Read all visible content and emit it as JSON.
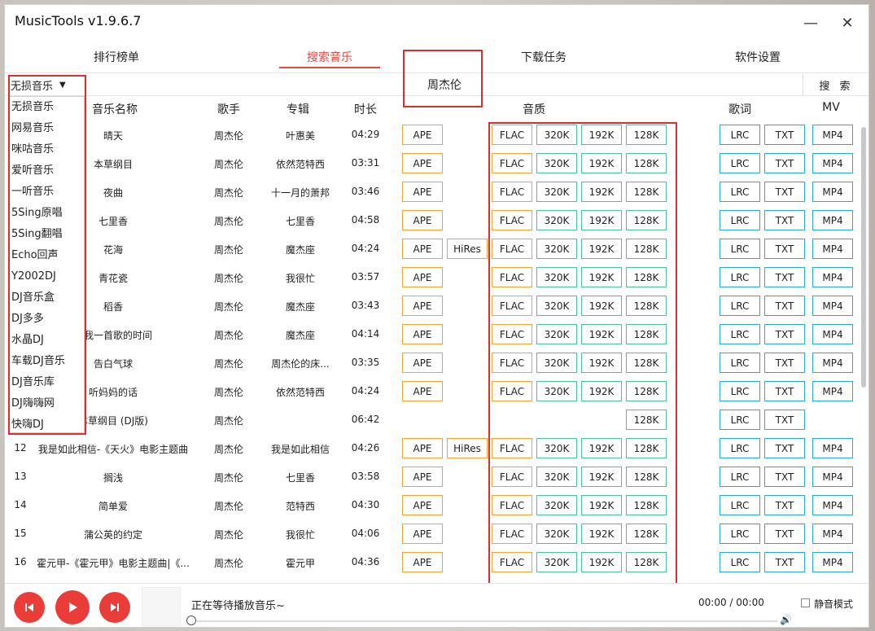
{
  "window": {
    "title": "MusicTools v1.9.6.7",
    "minimize": "—",
    "close": "✕"
  },
  "tabs": [
    {
      "label": "排行榜单"
    },
    {
      "label": "搜索音乐"
    },
    {
      "label": "下载任务"
    },
    {
      "label": "软件设置"
    }
  ],
  "active_tab": "搜索音乐",
  "search": {
    "source_selected": "无损音乐",
    "query": "周杰伦",
    "button": "搜 索"
  },
  "columns": {
    "title": "音乐名称",
    "artist": "歌手",
    "album": "专辑",
    "duration": "时长",
    "quality": "音质",
    "lyrics": "歌词",
    "mv": "MV"
  },
  "sources": [
    "无损音乐",
    "网易音乐",
    "咪咕音乐",
    "爱听音乐",
    "一听音乐",
    "5Sing原唱",
    "5Sing翻唱",
    "Echo回声",
    "Y2002DJ",
    "DJ音乐盒",
    "DJ多多",
    "水晶DJ",
    "车载DJ音乐",
    "DJ音乐库",
    "DJ嗨嗨网",
    "快嗨DJ"
  ],
  "songs": [
    {
      "num": "",
      "title": "晴天",
      "artist": "周杰伦",
      "album": "叶惠美",
      "duration": "04:29",
      "ape": "APE",
      "hires": "",
      "flac": "FLAC",
      "q320": "320K",
      "q192": "192K",
      "q128": "128K",
      "lrc": "LRC",
      "txt": "TXT",
      "mv": "MP4"
    },
    {
      "num": "",
      "title": "本草纲目",
      "artist": "周杰伦",
      "album": "依然范特西",
      "duration": "03:31",
      "ape": "APE",
      "hires": "",
      "flac": "FLAC",
      "q320": "320K",
      "q192": "192K",
      "q128": "128K",
      "lrc": "LRC",
      "txt": "TXT",
      "mv": "MP4"
    },
    {
      "num": "",
      "title": "夜曲",
      "artist": "周杰伦",
      "album": "十一月的萧邦",
      "duration": "03:46",
      "ape": "APE",
      "hires": "",
      "flac": "FLAC",
      "q320": "320K",
      "q192": "192K",
      "q128": "128K",
      "lrc": "LRC",
      "txt": "TXT",
      "mv": "MP4"
    },
    {
      "num": "",
      "title": "七里香",
      "artist": "周杰伦",
      "album": "七里香",
      "duration": "04:58",
      "ape": "APE",
      "hires": "",
      "flac": "FLAC",
      "q320": "320K",
      "q192": "192K",
      "q128": "128K",
      "lrc": "LRC",
      "txt": "TXT",
      "mv": "MP4"
    },
    {
      "num": "",
      "title": "花海",
      "artist": "周杰伦",
      "album": "魔杰座",
      "duration": "04:24",
      "ape": "APE",
      "hires": "HiRes",
      "flac": "FLAC",
      "q320": "320K",
      "q192": "192K",
      "q128": "128K",
      "lrc": "LRC",
      "txt": "TXT",
      "mv": "MP4"
    },
    {
      "num": "",
      "title": "青花瓷",
      "artist": "周杰伦",
      "album": "我很忙",
      "duration": "03:57",
      "ape": "APE",
      "hires": "",
      "flac": "FLAC",
      "q320": "320K",
      "q192": "192K",
      "q128": "128K",
      "lrc": "LRC",
      "txt": "TXT",
      "mv": "MP4"
    },
    {
      "num": "",
      "title": "稻香",
      "artist": "周杰伦",
      "album": "魔杰座",
      "duration": "03:43",
      "ape": "APE",
      "hires": "",
      "flac": "FLAC",
      "q320": "320K",
      "q192": "192K",
      "q128": "128K",
      "lrc": "LRC",
      "txt": "TXT",
      "mv": "MP4"
    },
    {
      "num": "",
      "title": "给我一首歌的时间",
      "artist": "周杰伦",
      "album": "魔杰座",
      "duration": "04:14",
      "ape": "APE",
      "hires": "",
      "flac": "FLAC",
      "q320": "320K",
      "q192": "192K",
      "q128": "128K",
      "lrc": "LRC",
      "txt": "TXT",
      "mv": "MP4"
    },
    {
      "num": "",
      "title": "告白气球",
      "artist": "周杰伦",
      "album": "周杰伦的床...",
      "duration": "03:35",
      "ape": "APE",
      "hires": "",
      "flac": "FLAC",
      "q320": "320K",
      "q192": "192K",
      "q128": "128K",
      "lrc": "LRC",
      "txt": "TXT",
      "mv": "MP4"
    },
    {
      "num": "",
      "title": "听妈妈的话",
      "artist": "周杰伦",
      "album": "依然范特西",
      "duration": "04:24",
      "ape": "APE",
      "hires": "",
      "flac": "FLAC",
      "q320": "320K",
      "q192": "192K",
      "q128": "128K",
      "lrc": "LRC",
      "txt": "TXT",
      "mv": "MP4"
    },
    {
      "num": "",
      "title": "本草纲目 (DJ版)",
      "artist": "周杰伦",
      "album": "",
      "duration": "06:42",
      "ape": "",
      "hires": "",
      "flac": "",
      "q320": "",
      "q192": "",
      "q128": "128K",
      "lrc": "LRC",
      "txt": "TXT",
      "mv": ""
    },
    {
      "num": "12",
      "title": "我是如此相信-《天火》电影主题曲",
      "artist": "周杰伦",
      "album": "我是如此相信",
      "duration": "04:26",
      "ape": "APE",
      "hires": "HiRes",
      "flac": "FLAC",
      "q320": "320K",
      "q192": "192K",
      "q128": "128K",
      "lrc": "LRC",
      "txt": "TXT",
      "mv": "MP4"
    },
    {
      "num": "13",
      "title": "搁浅",
      "artist": "周杰伦",
      "album": "七里香",
      "duration": "03:58",
      "ape": "APE",
      "hires": "",
      "flac": "FLAC",
      "q320": "320K",
      "q192": "192K",
      "q128": "128K",
      "lrc": "LRC",
      "txt": "TXT",
      "mv": "MP4"
    },
    {
      "num": "14",
      "title": "简单爱",
      "artist": "周杰伦",
      "album": "范特西",
      "duration": "04:30",
      "ape": "APE",
      "hires": "",
      "flac": "FLAC",
      "q320": "320K",
      "q192": "192K",
      "q128": "128K",
      "lrc": "LRC",
      "txt": "TXT",
      "mv": "MP4"
    },
    {
      "num": "15",
      "title": "蒲公英的约定",
      "artist": "周杰伦",
      "album": "我很忙",
      "duration": "04:06",
      "ape": "APE",
      "hires": "",
      "flac": "FLAC",
      "q320": "320K",
      "q192": "192K",
      "q128": "128K",
      "lrc": "LRC",
      "txt": "TXT",
      "mv": "MP4"
    },
    {
      "num": "16",
      "title": "霍元甲-《霍元甲》电影主题曲|《...",
      "artist": "周杰伦",
      "album": "霍元甲",
      "duration": "04:36",
      "ape": "APE",
      "hires": "",
      "flac": "FLAC",
      "q320": "320K",
      "q192": "192K",
      "q128": "128K",
      "lrc": "LRC",
      "txt": "TXT",
      "mv": "MP4"
    }
  ],
  "player": {
    "status": "正在等待播放音乐~",
    "time": "00:00 / 00:00",
    "mute_label": "静音模式",
    "prev_icon": "prev-icon",
    "play_icon": "play-icon",
    "next_icon": "next-icon",
    "volume_icon": "🔊"
  },
  "colors": {
    "accent": "#e8473f",
    "ape_border": "#f0a530",
    "quality_border": "#4cc29a",
    "lyrics_border": "#2ba9d6",
    "annotation": "#d9302f"
  }
}
